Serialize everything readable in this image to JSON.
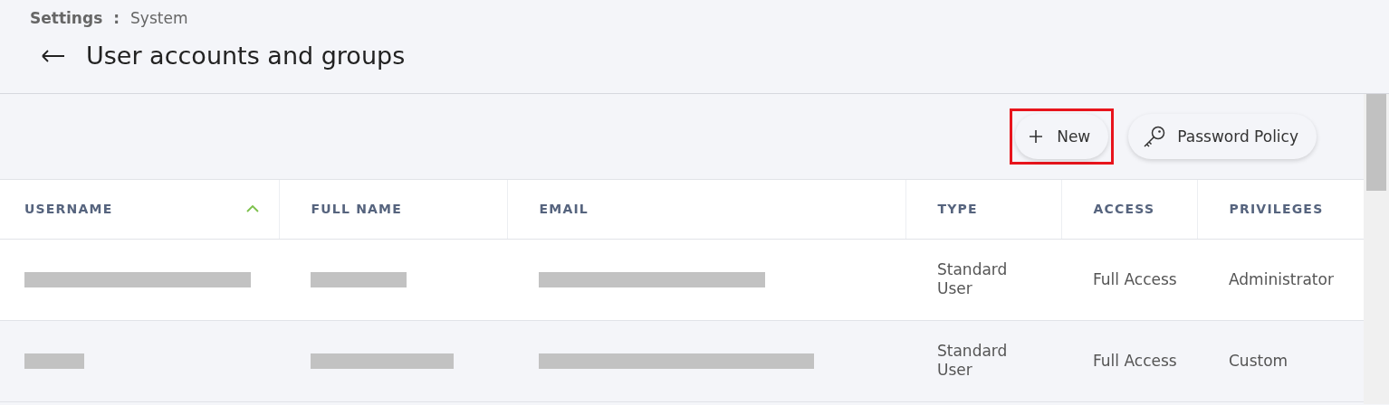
{
  "breadcrumb": {
    "parent": "Settings",
    "separator": ":",
    "current": "System"
  },
  "page_title": "User accounts and groups",
  "toolbar": {
    "buttons": [
      {
        "kind": "new",
        "label": "New",
        "highlighted": true
      },
      {
        "kind": "key",
        "label": "Password Policy",
        "highlighted": false
      }
    ]
  },
  "table": {
    "columns": [
      {
        "label": "USERNAME",
        "sorted": true
      },
      {
        "label": "FULL NAME",
        "sorted": false
      },
      {
        "label": "EMAIL",
        "sorted": false
      },
      {
        "label": "TYPE",
        "sorted": false
      },
      {
        "label": "ACCESS",
        "sorted": false
      },
      {
        "label": "PRIVILEGES",
        "sorted": false
      }
    ],
    "rows": [
      {
        "username": {
          "redacted": true
        },
        "full_name": {
          "redacted": true
        },
        "email": {
          "redacted": true
        },
        "type": "Standard User",
        "access": "Full Access",
        "privileges": "Administrator"
      },
      {
        "username": {
          "redacted": true
        },
        "full_name": {
          "redacted": true
        },
        "email": {
          "redacted": true
        },
        "type": "Standard User",
        "access": "Full Access",
        "privileges": "Custom"
      }
    ]
  }
}
